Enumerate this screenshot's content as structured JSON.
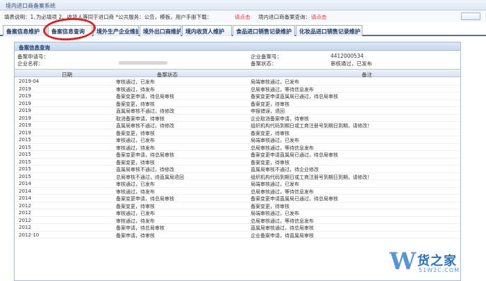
{
  "app": {
    "title": "境内进口商备案系统"
  },
  "notice": {
    "prefix": "填表说明：1、",
    "middle": "为必填项  2、收货人等同于进口商  *公共服务：公告，模板，用户手册下载：",
    "link1": "请点击",
    "query_label": "境内进口商备案查询：",
    "link2": "请点击"
  },
  "tabs": [
    {
      "label": "备案信息维护"
    },
    {
      "label": "备案信息查询"
    },
    {
      "label": "境外生产企业维护"
    },
    {
      "label": "境外出口商维护"
    },
    {
      "label": "境内收货人维护"
    },
    {
      "label": "食品进口销售记录维护"
    },
    {
      "label": "化妆品进口销售记录维护"
    }
  ],
  "panel": {
    "title": "备案信息查询",
    "apply_no_label": "备案申请号：",
    "company_label": "企业名称：",
    "record_no_label": "企业备案号：",
    "record_no_value": "4412000534",
    "status_label": "备案状态：",
    "status_value": "审核通过，已发布"
  },
  "table": {
    "headers": [
      "日期",
      "备案状态",
      "备注"
    ],
    "rows": [
      {
        "date": "2019-04",
        "status": "审核通过，已发布",
        "note": "局端审核通过，已发布"
      },
      {
        "date": "2019",
        "status": "审核通过，待发布",
        "note": "总局审核通过，等待信息发布"
      },
      {
        "date": "2019",
        "status": "备案变更申请，待总局审核",
        "note": "备案变更申请直属局已通过，待总局审核"
      },
      {
        "date": "2019",
        "status": "备案变更，待审核",
        "note": "备案变更，待审核"
      },
      {
        "date": "2019",
        "status": "直属局审核不通过，待修改",
        "note": "申报错误，退回"
      },
      {
        "date": "2019",
        "status": "取消备案申请，待审核",
        "note": "企业取消备案申请，待审核"
      },
      {
        "date": "2019",
        "status": "直属局审核不通过，待修改",
        "note": "组织机构代码到期日或工商注册号到期日到期，请修改！"
      },
      {
        "date": "2019",
        "status": "备案变更，待审核",
        "note": "备案变更，待审核"
      },
      {
        "date": "2015",
        "status": "审核通过，已发布",
        "note": "局端审核通过，已发布"
      },
      {
        "date": "2015",
        "status": "审核通过，待发布",
        "note": "总局审核通过，等待信息发布"
      },
      {
        "date": "2015",
        "status": "备案变更申请，待总局审核",
        "note": "备案变更申请直属局已通过，待总局审核"
      },
      {
        "date": "2015",
        "status": "备案变更，待审核",
        "note": "备案变更，待审核"
      },
      {
        "date": "2015",
        "status": "直属局审核不通过，待修改",
        "note": "直属局审核不通过，待企业修改"
      },
      {
        "date": "2015",
        "status": "总局审核不通过，待直属局退回",
        "note": "组织机构代码到期日或工商注册号到期日到期，请修改！"
      },
      {
        "date": "2014",
        "status": "审核通过，已发布",
        "note": "局端审核通过，已发布"
      },
      {
        "date": "2014",
        "status": "审核通过，待发布",
        "note": "总局审核通过，等待信息发布"
      },
      {
        "date": "2014",
        "status": "备案变更申请，待总局审核",
        "note": "备案变更申请直属局已通过，待总局审核"
      },
      {
        "date": "2012",
        "status": "备案变更，待审核",
        "note": "备案变更，待审核"
      },
      {
        "date": "2012",
        "status": "审核通过，已发布",
        "note": "局端审核通过，已发布"
      },
      {
        "date": "2012",
        "status": "审核通过，待发布",
        "note": "总局审核通过，等待信息发布"
      },
      {
        "date": "2012",
        "status": "备案申请，待总局审核",
        "note": "直属局审核通过，待总局审核"
      },
      {
        "date": "2012-10",
        "status": "备案申请，待审核",
        "note": "企业备案申请，待直属局审核"
      }
    ]
  },
  "watermark": {
    "letter": "W",
    "name": "货之家",
    "url": "51W2C.COM"
  },
  "colors": {
    "accent": "#4a6fa5",
    "link": "#e03030",
    "highlight": "#d42424"
  }
}
